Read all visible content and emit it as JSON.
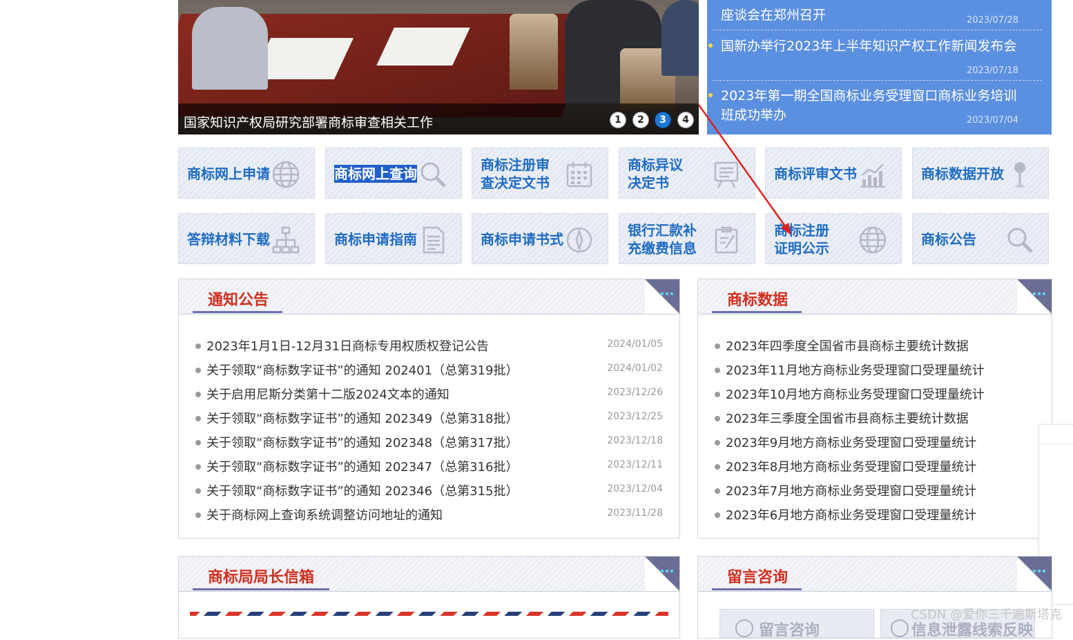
{
  "carousel": {
    "caption": "国家知识产权局研究部署商标审查相关工作",
    "dots": [
      "1",
      "2",
      "3",
      "4"
    ],
    "active_dot": 3
  },
  "news": {
    "items": [
      {
        "title": "座谈会在郑州召开",
        "date": "2023/07/28"
      },
      {
        "title": "国新办举行2023年上半年知识产权工作新闻发布会",
        "date": "2023/07/18"
      },
      {
        "title_line1": "2023年第一期全国商标业务受理窗口商标业务培训",
        "title_line2": "班成功举办",
        "date": "2023/07/04"
      }
    ]
  },
  "tiles": [
    {
      "label": "商标网上申请",
      "icon": "globe-icon"
    },
    {
      "label": "商标网上查询",
      "icon": "search-icon",
      "selected": true
    },
    {
      "label1": "商标注册审",
      "label2": "查决定文书",
      "icon": "calendar-icon"
    },
    {
      "label1": "商标异议",
      "label2": "决定书",
      "icon": "board-icon"
    },
    {
      "label": "商标评审文书",
      "icon": "chart-icon"
    },
    {
      "label": "商标数据开放",
      "icon": "pin-icon"
    },
    {
      "label": "答辩材料下载",
      "icon": "hierarchy-icon"
    },
    {
      "label": "商标申请指南",
      "icon": "document-icon"
    },
    {
      "label": "商标申请书式",
      "icon": "compass-icon"
    },
    {
      "label1": "银行汇款补",
      "label2": "充缴费信息",
      "icon": "edit-icon"
    },
    {
      "label1": "商标注册",
      "label2": "证明公示",
      "icon": "globe-icon"
    },
    {
      "label": "商标公告",
      "icon": "search-icon"
    }
  ],
  "notice": {
    "title": "通知公告",
    "items": [
      {
        "text": "2023年1月1日-12月31日商标专用权质权登记公告",
        "date": "2024/01/05"
      },
      {
        "text": "关于领取“商标数字证书”的通知 202401（总第319批）",
        "date": "2024/01/02"
      },
      {
        "text": "关于启用尼斯分类第十二版2024文本的通知",
        "date": "2023/12/26"
      },
      {
        "text": "关于领取“商标数字证书”的通知 202349（总第318批）",
        "date": "2023/12/25"
      },
      {
        "text": "关于领取“商标数字证书”的通知 202348（总第317批）",
        "date": "2023/12/18"
      },
      {
        "text": "关于领取“商标数字证书”的通知 202347（总第316批）",
        "date": "2023/12/11"
      },
      {
        "text": "关于领取“商标数字证书”的通知 202346（总第315批）",
        "date": "2023/12/04"
      },
      {
        "text": "关于商标网上查询系统调整访问地址的通知",
        "date": "2023/11/28"
      }
    ]
  },
  "data_panel": {
    "title": "商标数据",
    "items": [
      "2023年四季度全国省市县商标主要统计数据",
      "2023年11月地方商标业务受理窗口受理量统计",
      "2023年10月地方商标业务受理窗口受理量统计",
      "2023年三季度全国省市县商标主要统计数据",
      "2023年9月地方商标业务受理窗口受理量统计",
      "2023年8月地方商标业务受理窗口受理量统计",
      "2023年7月地方商标业务受理窗口受理量统计",
      "2023年6月地方商标业务受理窗口受理量统计"
    ]
  },
  "director_mailbox": {
    "title": "商标局局长信箱"
  },
  "consult": {
    "title": "留言咨询",
    "buttons": [
      "留言咨询",
      "信息泄露线索反映"
    ]
  },
  "watermark": "CSDN @爱你三千遍斯塔克",
  "colors": {
    "news_bg": "#5b8fe0",
    "tile_text": "#1f6cc4",
    "panel_title": "#d22e1e",
    "arrow": "#e02020"
  }
}
